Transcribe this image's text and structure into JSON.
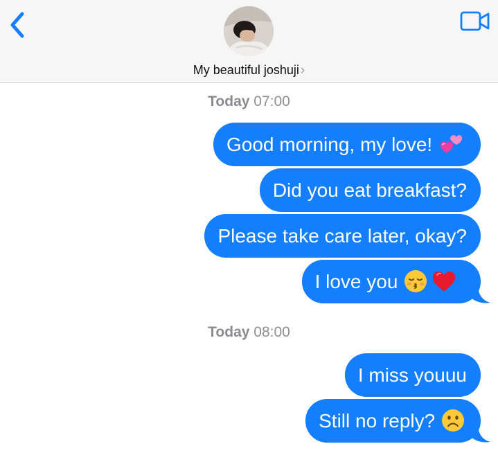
{
  "header": {
    "contact_name": "My beautiful joshuji",
    "chevron": "›",
    "back_icon": "chevron-left-icon",
    "video_icon": "video-camera-icon"
  },
  "colors": {
    "accent": "#147efb",
    "bubble_text": "#ffffff",
    "stamp_text": "#8e8e93",
    "header_bg": "#f6f6f7"
  },
  "conversation": [
    {
      "day": "Today",
      "time": "07:00",
      "messages": [
        {
          "text": "Good morning, my love!",
          "emoji": "two-hearts"
        },
        {
          "text": "Did you eat breakfast?"
        },
        {
          "text": "Please take care later, okay?"
        },
        {
          "text": "I love you",
          "emoji": "kissing-face-closed-eyes + red-heart",
          "tail": true
        }
      ]
    },
    {
      "day": "Today",
      "time": "08:00",
      "messages": [
        {
          "text": "I miss youuu"
        },
        {
          "text": "Still no reply?",
          "emoji": "frowning-face",
          "tail": true
        }
      ]
    }
  ]
}
